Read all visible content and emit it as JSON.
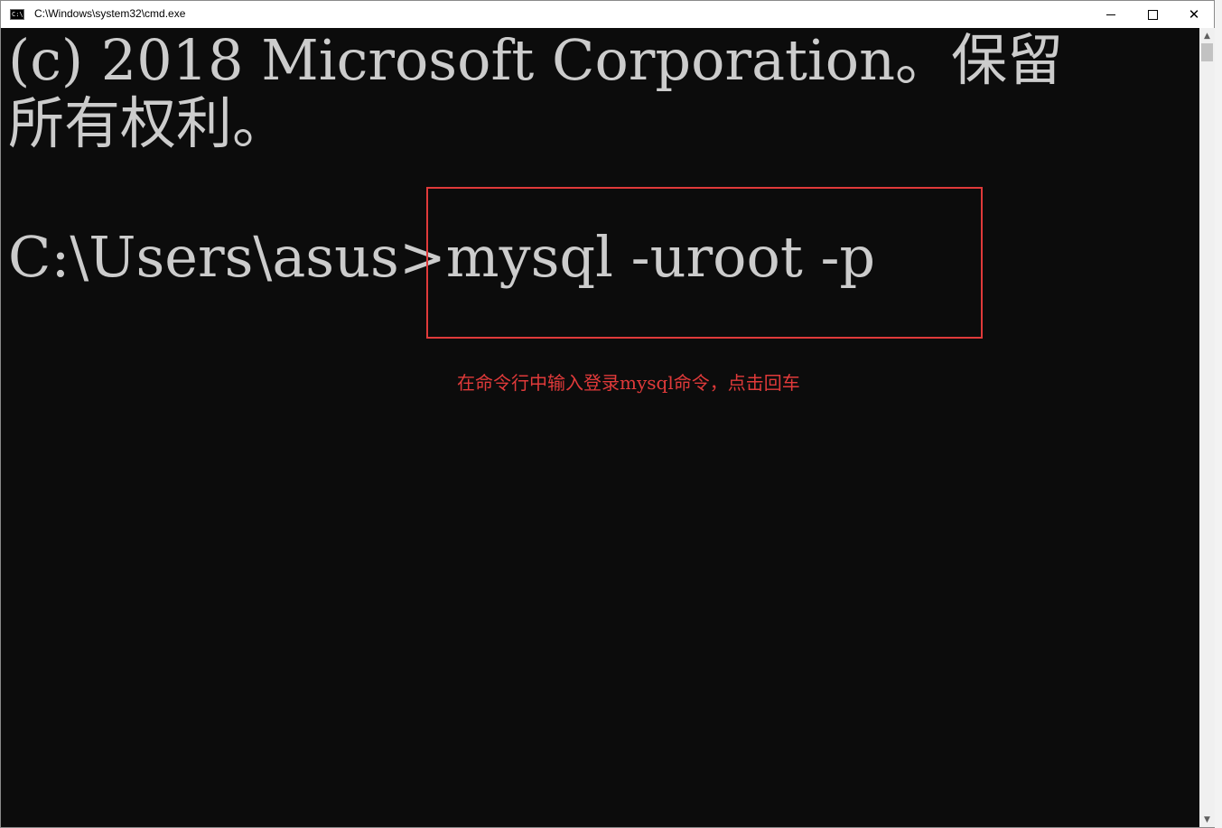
{
  "window": {
    "title": "C:\\Windows\\system32\\cmd.exe",
    "icon": "console-icon",
    "icon_text": "C:\\",
    "controls": {
      "minimize": "minimize-icon",
      "maximize": "maximize-icon",
      "close": "close-icon",
      "close_glyph": "✕"
    }
  },
  "console": {
    "lines": [
      "(c) 2018 Microsoft Corporation。保留",
      "所有权利。"
    ],
    "prompt": "C:\\Users\\asus>mysql -uroot -p"
  },
  "annotation": {
    "text": "在命令行中输入登录mysql命令，点击回车",
    "color": "#e03a3a"
  },
  "colors": {
    "console_bg": "#0c0c0c",
    "console_text": "#cccccc",
    "highlight": "#e03a3a"
  },
  "scrollbar": {
    "up": "▲",
    "down": "▼"
  }
}
